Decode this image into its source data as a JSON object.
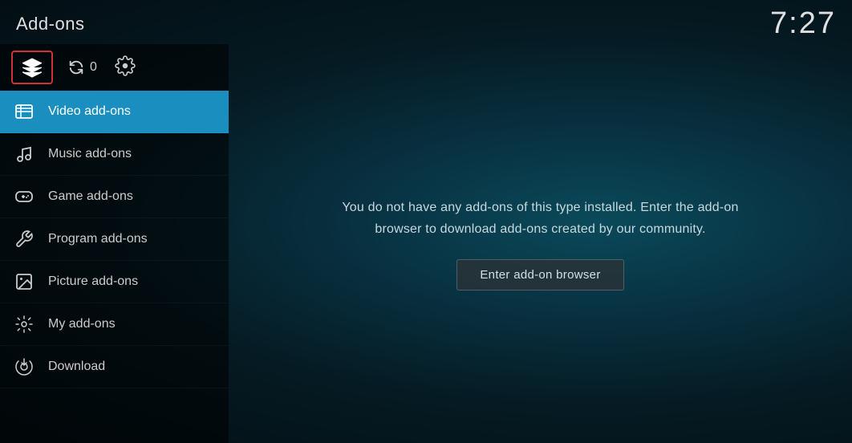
{
  "header": {
    "title": "Add-ons",
    "time": "7:27"
  },
  "toolbar": {
    "refresh_count": "0"
  },
  "nav": {
    "items": [
      {
        "id": "video",
        "label": "Video add-ons",
        "active": true,
        "icon": "video-icon"
      },
      {
        "id": "music",
        "label": "Music add-ons",
        "active": false,
        "icon": "music-icon"
      },
      {
        "id": "game",
        "label": "Game add-ons",
        "active": false,
        "icon": "game-icon"
      },
      {
        "id": "program",
        "label": "Program add-ons",
        "active": false,
        "icon": "program-icon"
      },
      {
        "id": "picture",
        "label": "Picture add-ons",
        "active": false,
        "icon": "picture-icon"
      },
      {
        "id": "myadd",
        "label": "My add-ons",
        "active": false,
        "icon": "myadd-icon"
      },
      {
        "id": "download",
        "label": "Download",
        "active": false,
        "icon": "download-icon"
      }
    ]
  },
  "content": {
    "empty_message": "You do not have any add-ons of this type installed. Enter the add-on browser to\ndownload add-ons created by our community.",
    "browser_button": "Enter add-on browser"
  }
}
